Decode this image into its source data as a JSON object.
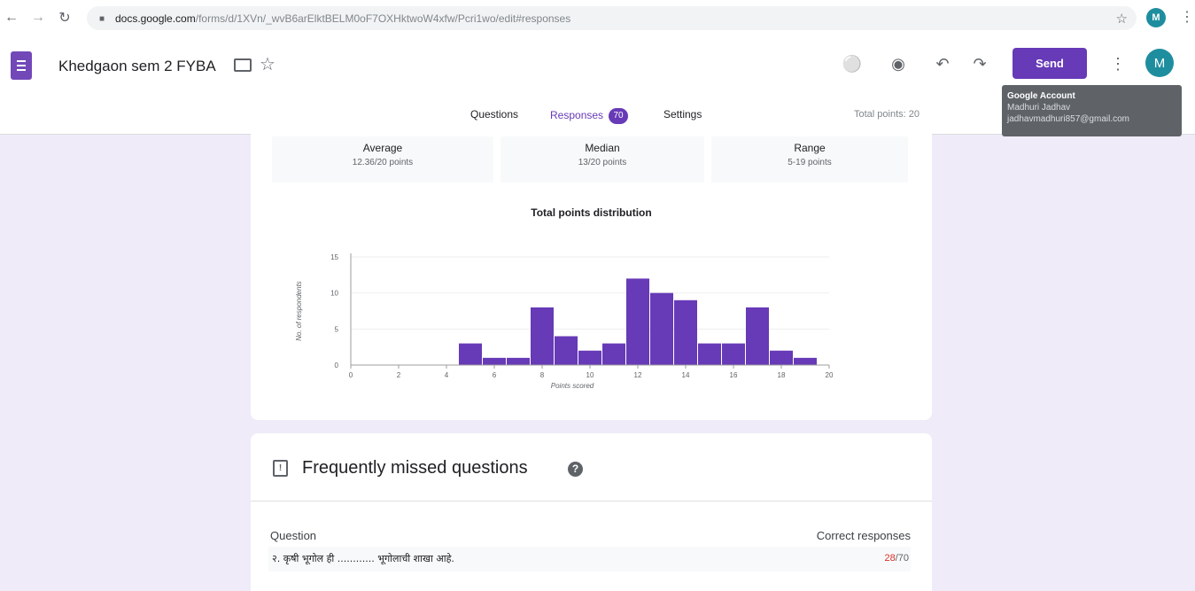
{
  "browser": {
    "url_host": "docs.google.com",
    "url_path": "/forms/d/1XVn/_wvB6arElktBELM0oF7OXHktwoW4xfw/Pcri1wo/edit#responses",
    "avatar_letter": "M"
  },
  "header": {
    "form_title": "Khedgaon sem 2 FYBA",
    "send_label": "Send",
    "avatar_letter": "M",
    "tooltip": {
      "title": "Google Account",
      "name": "Madhuri Jadhav",
      "email": "jadhavmadhuri857@gmail.com"
    },
    "tabs": [
      {
        "label": "Questions"
      },
      {
        "label": "Responses",
        "badge": "70"
      },
      {
        "label": "Settings"
      }
    ],
    "total_points": "Total points: 20"
  },
  "summary": {
    "stats": [
      {
        "label": "Average",
        "value": "12.36/20 points"
      },
      {
        "label": "Median",
        "value": "13/20 points"
      },
      {
        "label": "Range",
        "value": "5-19 points"
      }
    ]
  },
  "chart_data": {
    "type": "bar",
    "title": "Total points distribution",
    "xlabel": "Points scored",
    "ylabel": "No. of respondents",
    "x": [
      5,
      6,
      7,
      8,
      9,
      10,
      11,
      12,
      13,
      14,
      15,
      16,
      17,
      18,
      19
    ],
    "values": [
      3,
      1,
      1,
      8,
      4,
      2,
      3,
      12,
      10,
      9,
      3,
      3,
      8,
      2,
      1
    ],
    "xlim": [
      0,
      20
    ],
    "ylim": [
      0,
      15
    ],
    "xticks": [
      0,
      2,
      4,
      6,
      8,
      10,
      12,
      14,
      16,
      18,
      20
    ],
    "yticks": [
      0,
      5,
      10,
      15
    ],
    "color": "#673ab7",
    "grid": true
  },
  "missed": {
    "title": "Frequently missed questions",
    "col_question": "Question",
    "col_correct": "Correct responses",
    "rows": [
      {
        "question": "२. कृषी भूगोल ही ............ भूगोलाची शाखा आहे.",
        "correct": "28",
        "total": "/70"
      }
    ]
  },
  "colors": {
    "accent": "#673ab7",
    "background": "#f0ebf8",
    "missed_count": "#d93025"
  }
}
